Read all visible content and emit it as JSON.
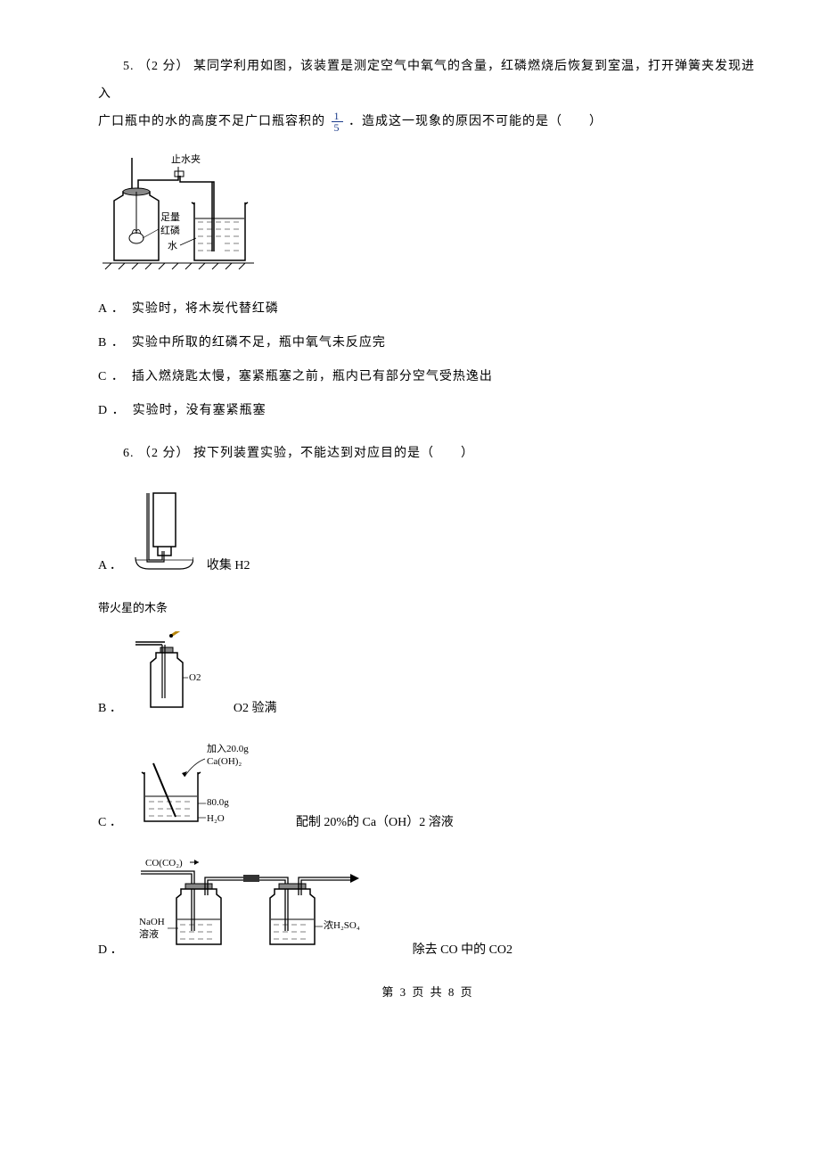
{
  "q5": {
    "number": "5.",
    "points": "（2 分）",
    "text_line1": "某同学利用如图，该装置是测定空气中氧气的含量，红磷燃烧后恢复到室温，打开弹簧夹发现进入",
    "text_line2_a": "广口瓶中的水的高度不足广口瓶容积的",
    "text_line2_b": "．造成这一现象的原因不可能的是（　　）",
    "fraction_num": "1",
    "fraction_den": "5",
    "diagram_labels": {
      "clamp": "止水夹",
      "phosphorus1": "足量",
      "phosphorus2": "红磷",
      "water": "水"
    },
    "options": {
      "A": {
        "label": "A ．",
        "text": "实验时，将木炭代替红磷"
      },
      "B": {
        "label": "B ．",
        "text": "实验中所取的红磷不足，瓶中氧气未反应完"
      },
      "C": {
        "label": "C ．",
        "text": "插入燃烧匙太慢，塞紧瓶塞之前，瓶内已有部分空气受热逸出"
      },
      "D": {
        "label": "D ．",
        "text": "实验时，没有塞紧瓶塞"
      }
    }
  },
  "q6": {
    "number": "6.",
    "points": "（2 分）",
    "text": "按下列装置实验，不能达到对应目的是（　　）",
    "options": {
      "A": {
        "label": "A ．",
        "text": "收集 H2"
      },
      "B": {
        "label": "B ．",
        "text": "O2 验满",
        "diag_top": "带火星的木条",
        "o2_label": "O2"
      },
      "C": {
        "label": "C ．",
        "text": "配制 20%的 Ca（OH）2 溶液",
        "caoh_top": "加入20.0g",
        "caoh_label": "Ca(OH)₂",
        "h2o_mass": "80.0g",
        "h2o_label": "H₂O"
      },
      "D": {
        "label": "D ．",
        "text": "除去 CO 中的 CO2",
        "gas_in": "CO(CO₂)",
        "naoh1": "NaOH",
        "naoh2": "溶液",
        "h2so4": "浓H₂SO₄"
      }
    }
  },
  "footer": "第 3 页 共 8 页"
}
